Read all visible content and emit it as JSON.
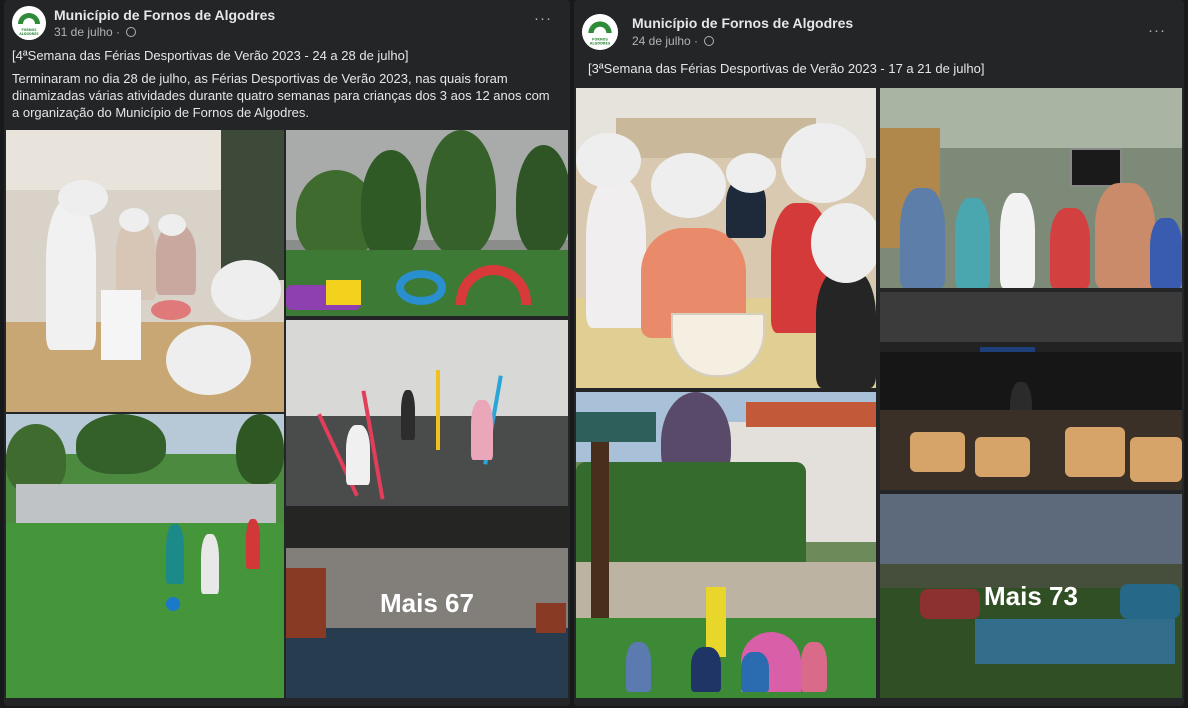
{
  "posts": [
    {
      "author": "Município de Fornos de Algodres",
      "date": "31 de julho",
      "more_label": "···",
      "title": "[4ªSemana das Férias Desportivas de Verão 2023 - 24 a 28 de julho]",
      "body": "Terminaram no dia 28 de julho, as Férias Desportivas de Verão 2023, nas quais foram dinamizadas várias atividades durante quatro semanas para crianças dos 3 aos 12 anos com a organização do Município de Fornos de Algodres.",
      "more_photos": "Mais 67"
    },
    {
      "author": "Município de Fornos de Algodres",
      "date": "24 de julho",
      "more_label": "···",
      "title": "[3ªSemana das Férias Desportivas de Verão 2023 -  17 a 21 de julho]",
      "more_photos": "Mais 73"
    }
  ],
  "logo_text": "FORNOS DE ALGODRES",
  "colors": {
    "card": "#242526",
    "background": "#18191a",
    "text": "#e4e6eb",
    "muted": "#b0b3b8",
    "logo_green": "#2e8b3a"
  }
}
